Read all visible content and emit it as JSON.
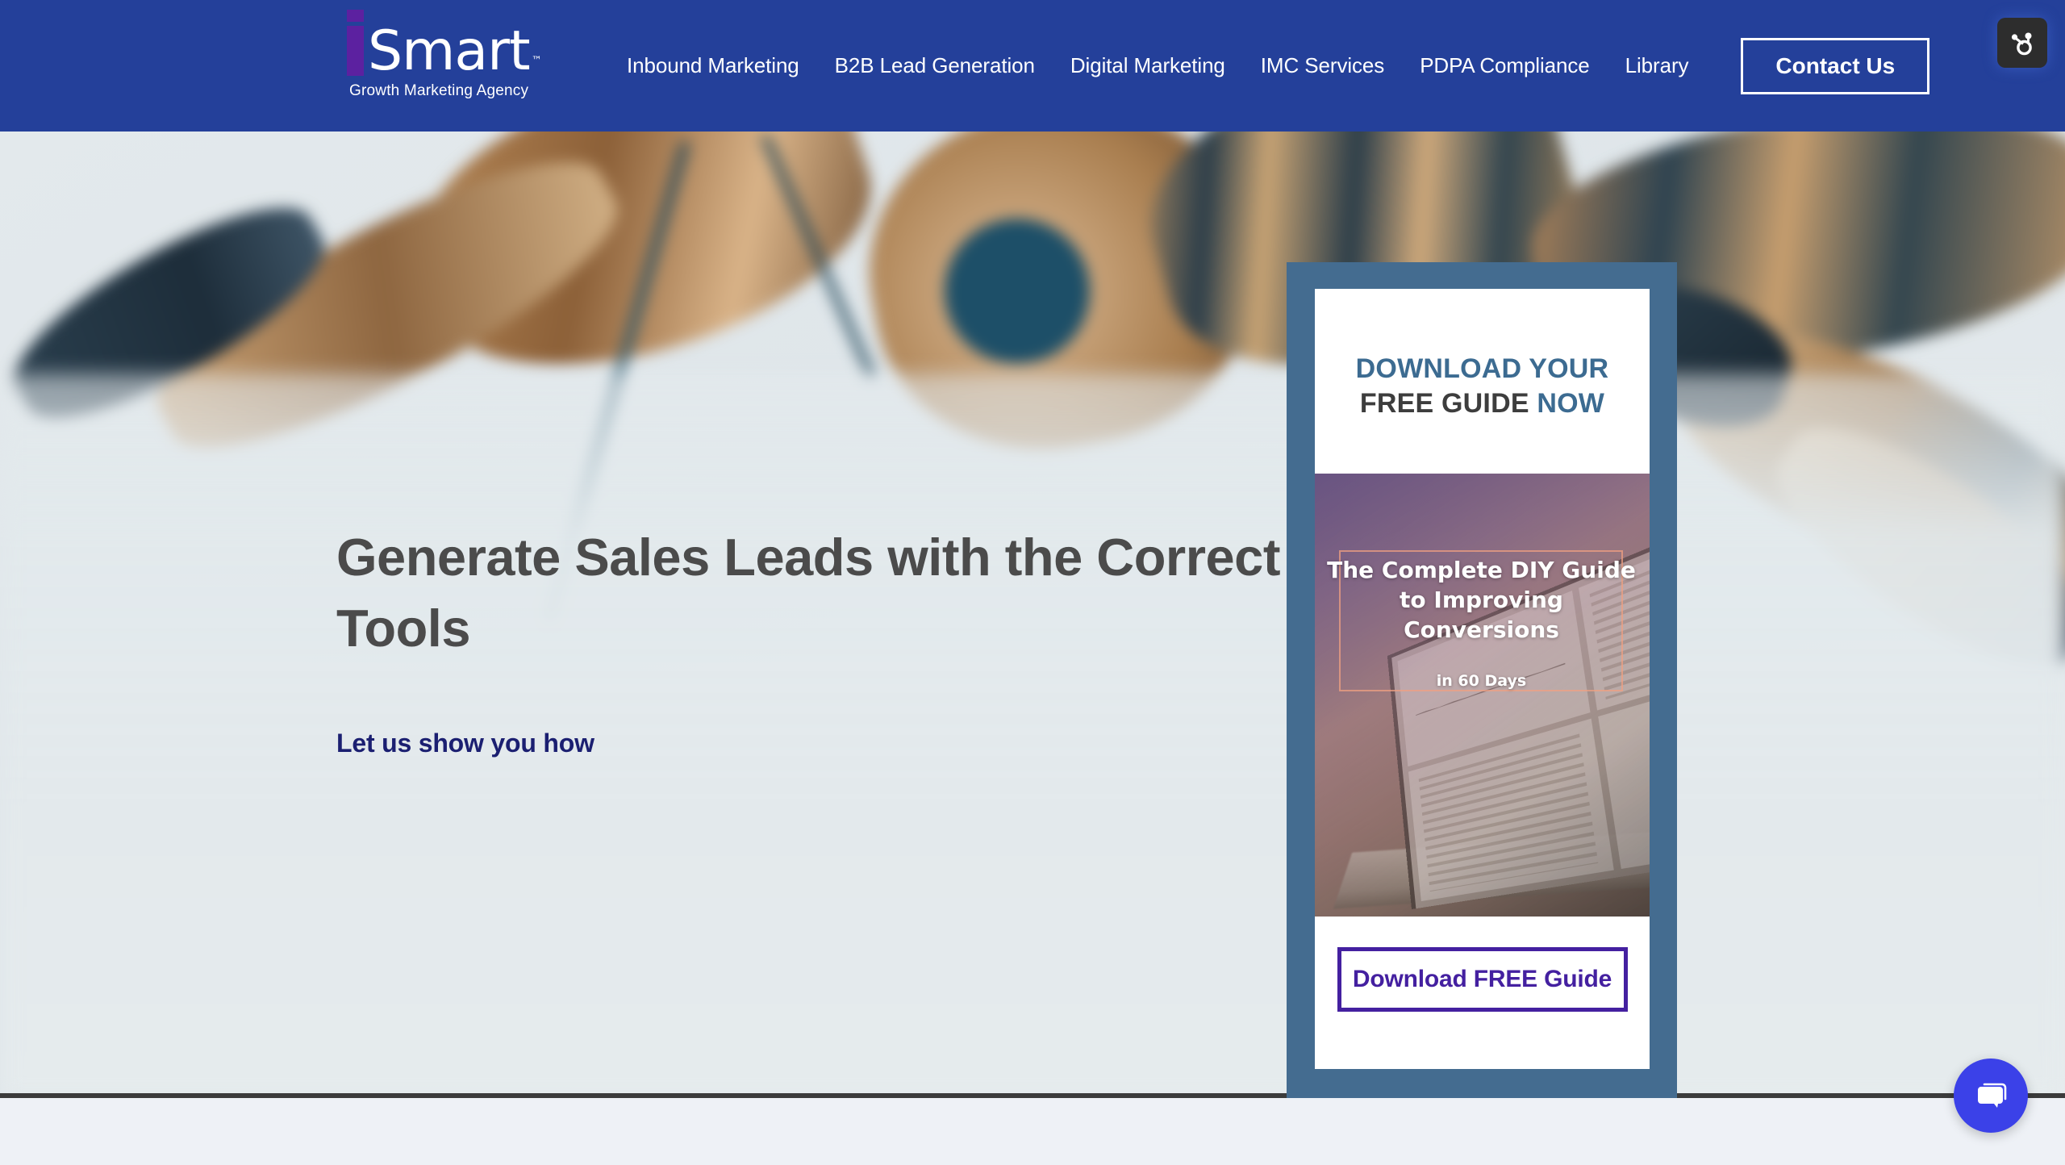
{
  "header": {
    "background_color": "#24409a",
    "logo": {
      "initial": "i",
      "word": "Smart",
      "trademark": "™",
      "tagline": "Growth Marketing Agency",
      "initial_color": "#5c21a0",
      "word_color": "#ffffff"
    },
    "nav_items": [
      {
        "label": "Inbound Marketing"
      },
      {
        "label": "B2B Lead Generation"
      },
      {
        "label": "Digital Marketing"
      },
      {
        "label": "IMC Services"
      },
      {
        "label": "PDPA Compliance"
      },
      {
        "label": "Library"
      }
    ],
    "contact_button": "Contact Us",
    "hubspot_badge": "hubspot-sprocket-icon"
  },
  "hero": {
    "headline": "Generate Sales Leads with the Correct Tools",
    "headline_color": "#4b4b4b",
    "subheadline": "Let us show you how",
    "subheadline_color": "#1b1f71",
    "background_description": "blurred photograph of wooden pencils tied with twine on a white paper surface"
  },
  "offer_card": {
    "frame_color": "#446c90",
    "heading_line1": "DOWNLOAD YOUR",
    "heading_line2_dark": "FREE GUIDE",
    "heading_line2_blue": "NOW",
    "heading_blue_color": "#3c6b91",
    "heading_dark_color": "#3d3d3d",
    "ebook": {
      "title": "The Complete DIY Guide to Improving Conversions",
      "subtitle": "in 60 Days",
      "cover_description": "laptop displaying an analytics dashboard under a purple gradient overlay",
      "frame_border_color": "#f0a082"
    },
    "cta_button": "Download FREE Guide",
    "cta_color": "#4420a0"
  },
  "chat_widget": {
    "icon": "chat-bubble-icon",
    "color": "#3b41e8"
  }
}
